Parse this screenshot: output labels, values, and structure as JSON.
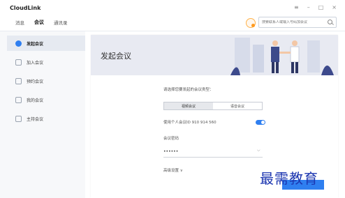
{
  "app": {
    "title": "CloudLink"
  },
  "nav": {
    "items": [
      "消息",
      "会议",
      "通讯录"
    ],
    "active": "会议"
  },
  "search": {
    "placeholder": "搜索联系人或输入号码加会议"
  },
  "sidebar": {
    "items": [
      {
        "label": "发起会议",
        "active": true
      },
      {
        "label": "加入会议",
        "active": false
      },
      {
        "label": "预约会议",
        "active": false
      },
      {
        "label": "我的会议",
        "active": false
      },
      {
        "label": "主持会议",
        "active": false
      }
    ]
  },
  "main": {
    "banner_title": "发起会议",
    "type_prompt": "请选择您要发起的会议类型：",
    "type_options": [
      "视频会议",
      "语音会议"
    ],
    "selected_type": "视频会议",
    "personal_id_label": "使用个人会议ID 910 914 560",
    "personal_id_enabled": true,
    "password_label": "会议密码",
    "password_value": "••••••",
    "advanced_label": "高级设置 ∨"
  },
  "watermark": "最需教育",
  "colors": {
    "accent": "#2f7ff0",
    "watermark": "#1c36b0"
  }
}
